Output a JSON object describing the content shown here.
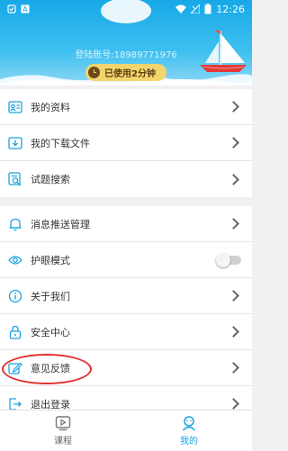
{
  "status_bar": {
    "time": "12:26",
    "icons": [
      "notification-icon",
      "a-badge-icon",
      "wifi-icon",
      "no-signal-icon",
      "battery-icon"
    ]
  },
  "header": {
    "account_text": "登陆账号:18989771976",
    "usage_text": "已使用2分钟",
    "colors": {
      "sky": "#17a8e8",
      "pill": "#f3d56e"
    }
  },
  "menu": {
    "section1": [
      {
        "label": "我的资料",
        "icon": "profile-card-icon"
      },
      {
        "label": "我的下载文件",
        "icon": "download-folder-icon"
      },
      {
        "label": "试题搜索",
        "icon": "search-document-icon"
      }
    ],
    "section2": [
      {
        "label": "消息推送管理",
        "icon": "bell-icon"
      },
      {
        "label": "护眼模式",
        "icon": "eye-icon",
        "toggle": "off"
      },
      {
        "label": "关于我们",
        "icon": "info-icon"
      },
      {
        "label": "安全中心",
        "icon": "lock-icon"
      },
      {
        "label": "意见反馈",
        "icon": "edit-icon"
      },
      {
        "label": "退出登录",
        "icon": "logout-icon"
      }
    ]
  },
  "tabs": [
    {
      "label": "课程",
      "icon": "play-video-icon",
      "active": false
    },
    {
      "label": "我的",
      "icon": "person-icon",
      "active": true
    }
  ],
  "accent_color": "#1aa3e0",
  "annotation_color": "#e0312b"
}
